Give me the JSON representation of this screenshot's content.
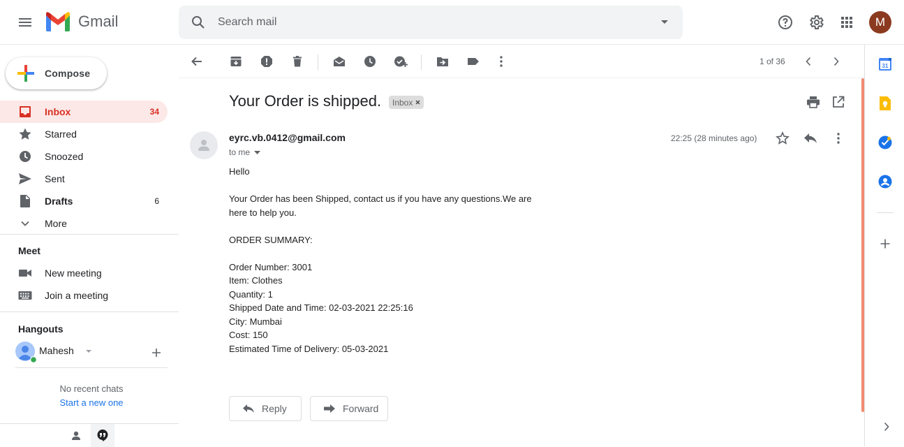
{
  "app": {
    "name": "Gmail"
  },
  "search": {
    "placeholder": "Search mail"
  },
  "user": {
    "avatar_letter": "M",
    "avatar_color": "#8b3a1f"
  },
  "compose": {
    "label": "Compose"
  },
  "nav": {
    "inbox": {
      "label": "Inbox",
      "count": "34"
    },
    "starred": {
      "label": "Starred"
    },
    "snoozed": {
      "label": "Snoozed"
    },
    "sent": {
      "label": "Sent"
    },
    "drafts": {
      "label": "Drafts",
      "count": "6"
    },
    "more": {
      "label": "More"
    }
  },
  "meet": {
    "title": "Meet",
    "new_meeting": "New meeting",
    "join_meeting": "Join a meeting"
  },
  "hangouts": {
    "title": "Hangouts",
    "user": "Mahesh",
    "no_chats": "No recent chats",
    "start_new": "Start a new one"
  },
  "toolbar": {
    "pager": "1 of 36"
  },
  "message": {
    "subject": "Your Order is shipped.",
    "label": "Inbox",
    "sender": "eyrc.vb.0412@gmail.com",
    "to": "to me",
    "time": "22:25 (28 minutes ago)",
    "body": {
      "greeting": "Hello",
      "line1": "Your Order has been Shipped, contact us if you have any questions.We are",
      "line2": "here to help you.",
      "summary_title": "ORDER SUMMARY:",
      "order_number": "Order Number: 3001",
      "item": "Item: Clothes",
      "quantity": "Quantity: 1",
      "shipped": "Shipped Date and Time: 02-03-2021 22:25:16",
      "city": "City: Mumbai",
      "cost": "Cost: 150",
      "eta": "Estimated Time of Delivery: 05-03-2021"
    }
  },
  "actions": {
    "reply": "Reply",
    "forward": "Forward"
  },
  "colors": {
    "accent": "#d93025",
    "active_bg": "#fce8e6",
    "link": "#1a73e8",
    "scrollbar": "#f28b71"
  }
}
